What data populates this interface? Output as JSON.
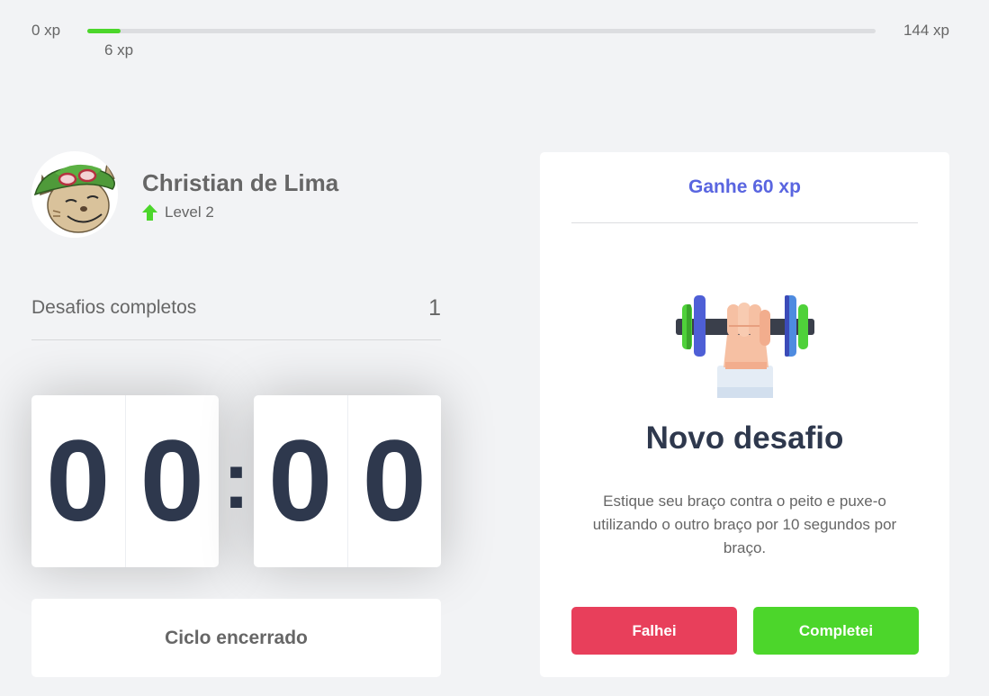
{
  "experience": {
    "min_label": "0 xp",
    "max_label": "144 xp",
    "current_label": "6 xp",
    "progress_fraction": 0.042,
    "bar_color": "#4cd62b"
  },
  "profile": {
    "name": "Christian de Lima",
    "level_label": "Level 2",
    "level_icon": "level-up-arrow-icon"
  },
  "completed_challenges": {
    "label": "Desafios completos",
    "count": "1"
  },
  "countdown": {
    "minutes": [
      "0",
      "0"
    ],
    "separator": ":",
    "seconds": [
      "0",
      "0"
    ],
    "button_label": "Ciclo encerrado"
  },
  "challenge": {
    "reward": "Ganhe 60 xp",
    "icon": "dumbbell-arm-icon",
    "title": "Novo desafio",
    "description": "Estique seu braço contra o peito e puxe-o utilizando o outro braço por 10 segundos por braço.",
    "fail_label": "Falhei",
    "success_label": "Completei"
  },
  "colors": {
    "background": "#f2f3f5",
    "accent": "#5965e0",
    "danger": "#e83f5b",
    "success": "#4cd62b",
    "title": "#2e384d",
    "text": "#666666"
  }
}
